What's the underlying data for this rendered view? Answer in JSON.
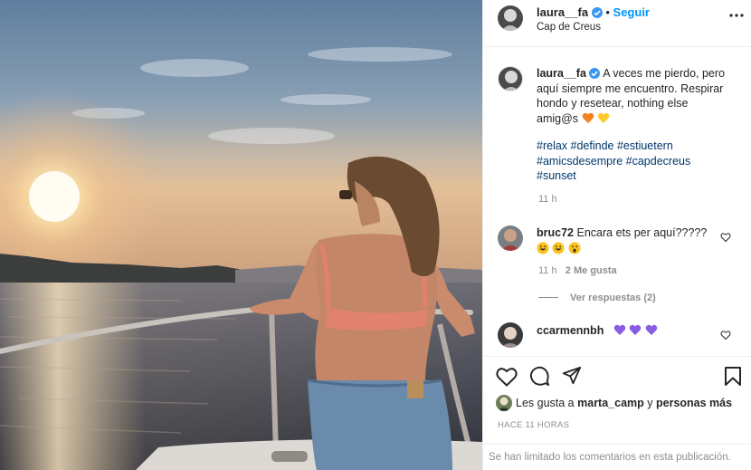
{
  "post": {
    "author": "laura__fa",
    "follow_label": "Seguir",
    "location": "Cap de Creus",
    "more_icon": "more-horizontal-icon",
    "caption_lines": [
      "A veces me pierdo, pero",
      "aquí siempre me encuentro. Respirar",
      "hondo y resetear, nothing else",
      "amig@s"
    ],
    "caption_emojis": [
      "orange-heart",
      "yellow-heart"
    ],
    "hashtag_lines": [
      "#relax #definde #estiuetern",
      "#amicsdesempre #capdecreus",
      "#sunset"
    ],
    "caption_time": "11 h"
  },
  "comments": [
    {
      "user": "bruc72",
      "text": "Encara ets per aquí?????",
      "emojis": [
        "grinning-face",
        "grinning-face",
        "surprised-face"
      ],
      "time": "11 h",
      "likes": "2 Me gusta",
      "view_replies": "Ver respuestas (2)"
    },
    {
      "user": "ccarmennbh",
      "emojis": [
        "purple-heart",
        "purple-heart",
        "purple-heart"
      ]
    }
  ],
  "actions": {
    "like_icon": "heart-icon",
    "comment_icon": "comment-icon",
    "share_icon": "send-icon",
    "save_icon": "bookmark-icon",
    "likes_prefix": "Les gusta a",
    "likes_user": "marta_camp",
    "likes_mid": "y",
    "likes_more": "personas más",
    "timestamp": "HACE 11 HORAS",
    "limited_comments": "Se han limitado los comentarios en esta publicación."
  },
  "colors": {
    "link_blue": "#0095f6",
    "hashtag": "#00376b",
    "secondary_text": "#8e8e8e",
    "verified_blue": "#3897f0"
  }
}
